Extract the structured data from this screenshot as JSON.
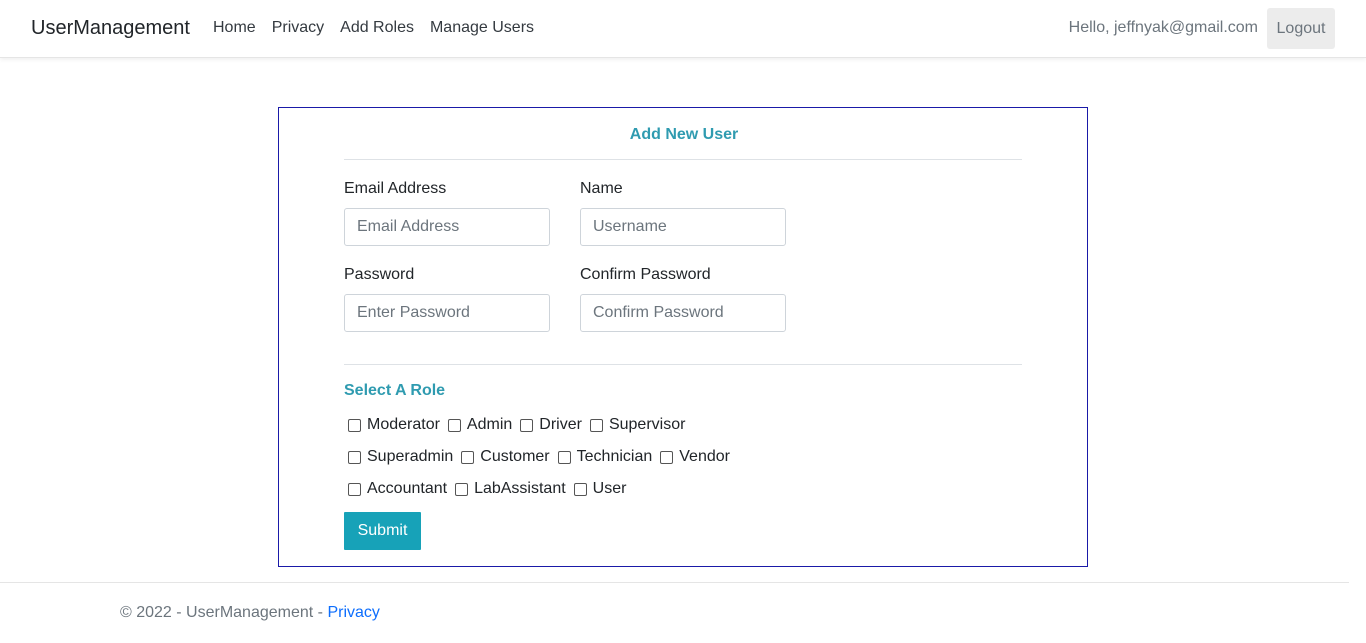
{
  "navbar": {
    "brand": "UserManagement",
    "links": [
      "Home",
      "Privacy",
      "Add Roles",
      "Manage Users"
    ],
    "greeting": "Hello, jeffnyak@gmail.com",
    "logout_label": "Logout"
  },
  "form": {
    "title": "Add New User",
    "email": {
      "label": "Email Address",
      "placeholder": "Email Address",
      "value": ""
    },
    "name": {
      "label": "Name",
      "placeholder": "Username",
      "value": ""
    },
    "password": {
      "label": "Password",
      "placeholder": "Enter Password",
      "value": ""
    },
    "confirm_password": {
      "label": "Confirm Password",
      "placeholder": "Confirm Password",
      "value": ""
    },
    "role_heading": "Select A Role",
    "roles": [
      [
        "Moderator",
        "Admin",
        "Driver",
        "Supervisor"
      ],
      [
        "Superadmin",
        "Customer",
        "Technician",
        "Vendor"
      ],
      [
        "Accountant",
        "LabAssistant",
        "User"
      ]
    ],
    "submit_label": "Submit"
  },
  "footer": {
    "text": "© 2022 - UserManagement - ",
    "link": "Privacy"
  },
  "colors": {
    "accent": "#17a2b8",
    "heading": "#2f9bb0",
    "card_border": "#1a1aa8",
    "link": "#0d6efd"
  }
}
